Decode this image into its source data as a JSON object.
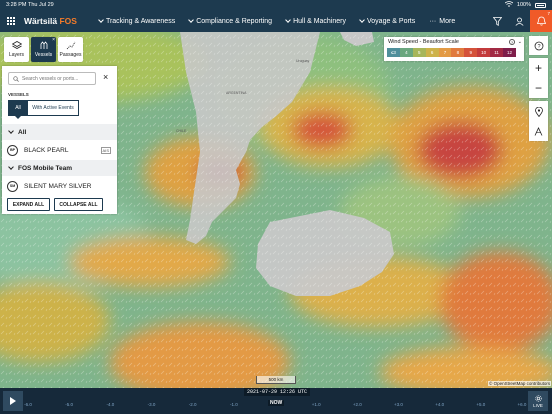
{
  "status": {
    "time": "3:28 PM",
    "date": "Thu Jul 29",
    "battery": "100%"
  },
  "brand": {
    "name": "Wärtsilä",
    "product": "FOS"
  },
  "nav": {
    "items": [
      "Tracking & Awareness",
      "Compliance & Reporting",
      "Hull & Machinery",
      "Voyage & Ports",
      "More"
    ],
    "alert_count": "7"
  },
  "tools": {
    "layers": "Layers",
    "vessels": "Vessels",
    "passages": "Passages"
  },
  "panel": {
    "search_placeholder": "Search vessels or ports...",
    "section_label": "VESSELS",
    "filter_all": "All",
    "filter_active": "With Active Events",
    "groups": [
      {
        "name": "All",
        "vessels": [
          {
            "initials": "BP",
            "name": "BLACK PEARL",
            "tag": "AIS"
          }
        ]
      },
      {
        "name": "FOS Mobile Team",
        "vessels": [
          {
            "initials": "SM",
            "name": "SILENT MARY SILVER"
          }
        ]
      }
    ],
    "expand_all": "EXPAND ALL",
    "collapse_all": "COLLAPSE ALL"
  },
  "legend": {
    "title": "Wind Speed - Beaufort Scale",
    "levels": [
      "≤3",
      "4",
      "5",
      "6",
      "7",
      "8",
      "9",
      "10",
      "11",
      "12"
    ],
    "colors": [
      "#4f8f9b",
      "#6ba77f",
      "#a7b65a",
      "#cdb24a",
      "#e39a44",
      "#e07a3e",
      "#d4523a",
      "#c33b3c",
      "#a22a44",
      "#7e1e4a"
    ]
  },
  "map": {
    "labels": [
      "ARGENTINA",
      "CHILE",
      "Uruguay"
    ],
    "scale_label": "500 km",
    "attribution": "© OpenStreetMap contributors"
  },
  "timeline": {
    "current_time": "2021-07-29 12:26 UTC",
    "now_label": "NOW",
    "live_label": "LIVE",
    "ticks": [
      "-6.0",
      "-5.0",
      "-4.0",
      "-3.0",
      "-2.0",
      "-1.0",
      "NOW",
      "+1.0",
      "+2.0",
      "+3.0",
      "+4.0",
      "+5.0",
      "+6.0"
    ]
  }
}
